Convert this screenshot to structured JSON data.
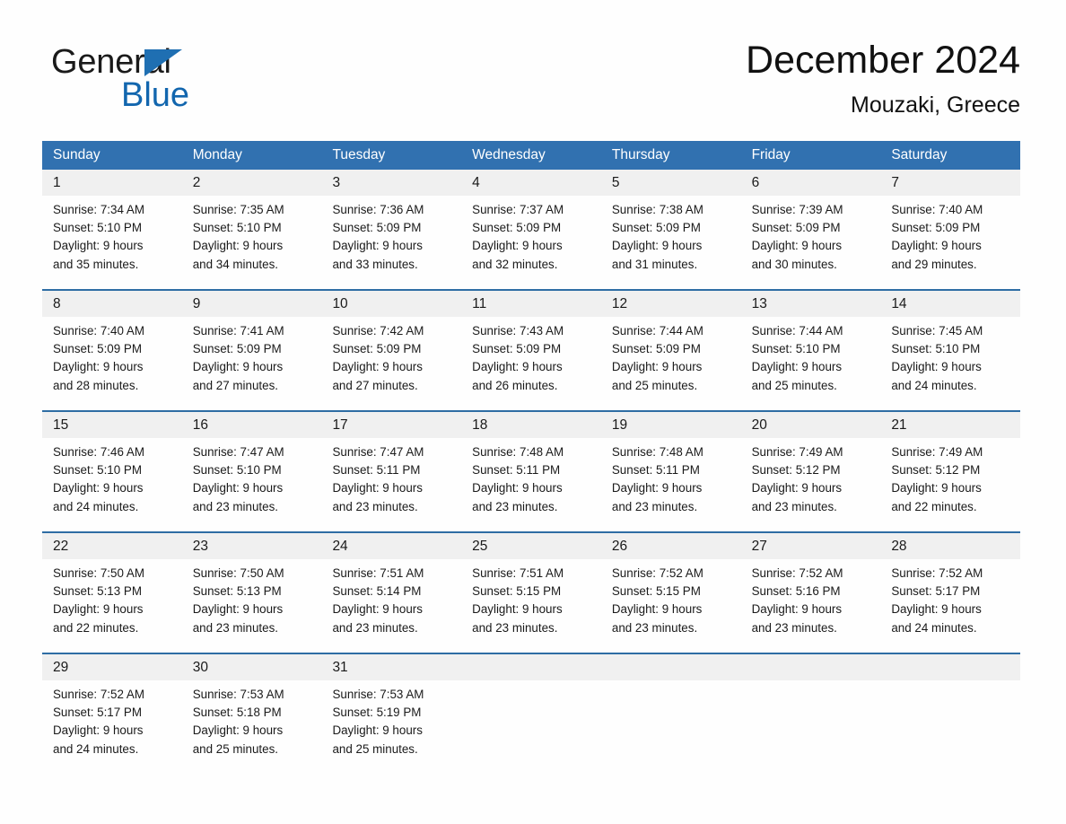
{
  "brand": {
    "name_part1": "General",
    "name_part2": "Blue",
    "triangle_color": "#1f6fb2",
    "blue_text_color": "#1266ae"
  },
  "header": {
    "title": "December 2024",
    "subtitle": "Mouzaki, Greece"
  },
  "theme": {
    "header_blue": "#3171b0",
    "divider_blue": "#2e6da4",
    "date_strip_gray": "#f0f0f0",
    "page_background": "#fefefe",
    "text_color": "#1a1a1a"
  },
  "weekdays": [
    "Sunday",
    "Monday",
    "Tuesday",
    "Wednesday",
    "Thursday",
    "Friday",
    "Saturday"
  ],
  "weeks": [
    {
      "days": [
        {
          "date": "1",
          "sunrise": "Sunrise: 7:34 AM",
          "sunset": "Sunset: 5:10 PM",
          "daylight_1": "Daylight: 9 hours",
          "daylight_2": "and 35 minutes."
        },
        {
          "date": "2",
          "sunrise": "Sunrise: 7:35 AM",
          "sunset": "Sunset: 5:10 PM",
          "daylight_1": "Daylight: 9 hours",
          "daylight_2": "and 34 minutes."
        },
        {
          "date": "3",
          "sunrise": "Sunrise: 7:36 AM",
          "sunset": "Sunset: 5:09 PM",
          "daylight_1": "Daylight: 9 hours",
          "daylight_2": "and 33 minutes."
        },
        {
          "date": "4",
          "sunrise": "Sunrise: 7:37 AM",
          "sunset": "Sunset: 5:09 PM",
          "daylight_1": "Daylight: 9 hours",
          "daylight_2": "and 32 minutes."
        },
        {
          "date": "5",
          "sunrise": "Sunrise: 7:38 AM",
          "sunset": "Sunset: 5:09 PM",
          "daylight_1": "Daylight: 9 hours",
          "daylight_2": "and 31 minutes."
        },
        {
          "date": "6",
          "sunrise": "Sunrise: 7:39 AM",
          "sunset": "Sunset: 5:09 PM",
          "daylight_1": "Daylight: 9 hours",
          "daylight_2": "and 30 minutes."
        },
        {
          "date": "7",
          "sunrise": "Sunrise: 7:40 AM",
          "sunset": "Sunset: 5:09 PM",
          "daylight_1": "Daylight: 9 hours",
          "daylight_2": "and 29 minutes."
        }
      ]
    },
    {
      "days": [
        {
          "date": "8",
          "sunrise": "Sunrise: 7:40 AM",
          "sunset": "Sunset: 5:09 PM",
          "daylight_1": "Daylight: 9 hours",
          "daylight_2": "and 28 minutes."
        },
        {
          "date": "9",
          "sunrise": "Sunrise: 7:41 AM",
          "sunset": "Sunset: 5:09 PM",
          "daylight_1": "Daylight: 9 hours",
          "daylight_2": "and 27 minutes."
        },
        {
          "date": "10",
          "sunrise": "Sunrise: 7:42 AM",
          "sunset": "Sunset: 5:09 PM",
          "daylight_1": "Daylight: 9 hours",
          "daylight_2": "and 27 minutes."
        },
        {
          "date": "11",
          "sunrise": "Sunrise: 7:43 AM",
          "sunset": "Sunset: 5:09 PM",
          "daylight_1": "Daylight: 9 hours",
          "daylight_2": "and 26 minutes."
        },
        {
          "date": "12",
          "sunrise": "Sunrise: 7:44 AM",
          "sunset": "Sunset: 5:09 PM",
          "daylight_1": "Daylight: 9 hours",
          "daylight_2": "and 25 minutes."
        },
        {
          "date": "13",
          "sunrise": "Sunrise: 7:44 AM",
          "sunset": "Sunset: 5:10 PM",
          "daylight_1": "Daylight: 9 hours",
          "daylight_2": "and 25 minutes."
        },
        {
          "date": "14",
          "sunrise": "Sunrise: 7:45 AM",
          "sunset": "Sunset: 5:10 PM",
          "daylight_1": "Daylight: 9 hours",
          "daylight_2": "and 24 minutes."
        }
      ]
    },
    {
      "days": [
        {
          "date": "15",
          "sunrise": "Sunrise: 7:46 AM",
          "sunset": "Sunset: 5:10 PM",
          "daylight_1": "Daylight: 9 hours",
          "daylight_2": "and 24 minutes."
        },
        {
          "date": "16",
          "sunrise": "Sunrise: 7:47 AM",
          "sunset": "Sunset: 5:10 PM",
          "daylight_1": "Daylight: 9 hours",
          "daylight_2": "and 23 minutes."
        },
        {
          "date": "17",
          "sunrise": "Sunrise: 7:47 AM",
          "sunset": "Sunset: 5:11 PM",
          "daylight_1": "Daylight: 9 hours",
          "daylight_2": "and 23 minutes."
        },
        {
          "date": "18",
          "sunrise": "Sunrise: 7:48 AM",
          "sunset": "Sunset: 5:11 PM",
          "daylight_1": "Daylight: 9 hours",
          "daylight_2": "and 23 minutes."
        },
        {
          "date": "19",
          "sunrise": "Sunrise: 7:48 AM",
          "sunset": "Sunset: 5:11 PM",
          "daylight_1": "Daylight: 9 hours",
          "daylight_2": "and 23 minutes."
        },
        {
          "date": "20",
          "sunrise": "Sunrise: 7:49 AM",
          "sunset": "Sunset: 5:12 PM",
          "daylight_1": "Daylight: 9 hours",
          "daylight_2": "and 23 minutes."
        },
        {
          "date": "21",
          "sunrise": "Sunrise: 7:49 AM",
          "sunset": "Sunset: 5:12 PM",
          "daylight_1": "Daylight: 9 hours",
          "daylight_2": "and 22 minutes."
        }
      ]
    },
    {
      "days": [
        {
          "date": "22",
          "sunrise": "Sunrise: 7:50 AM",
          "sunset": "Sunset: 5:13 PM",
          "daylight_1": "Daylight: 9 hours",
          "daylight_2": "and 22 minutes."
        },
        {
          "date": "23",
          "sunrise": "Sunrise: 7:50 AM",
          "sunset": "Sunset: 5:13 PM",
          "daylight_1": "Daylight: 9 hours",
          "daylight_2": "and 23 minutes."
        },
        {
          "date": "24",
          "sunrise": "Sunrise: 7:51 AM",
          "sunset": "Sunset: 5:14 PM",
          "daylight_1": "Daylight: 9 hours",
          "daylight_2": "and 23 minutes."
        },
        {
          "date": "25",
          "sunrise": "Sunrise: 7:51 AM",
          "sunset": "Sunset: 5:15 PM",
          "daylight_1": "Daylight: 9 hours",
          "daylight_2": "and 23 minutes."
        },
        {
          "date": "26",
          "sunrise": "Sunrise: 7:52 AM",
          "sunset": "Sunset: 5:15 PM",
          "daylight_1": "Daylight: 9 hours",
          "daylight_2": "and 23 minutes."
        },
        {
          "date": "27",
          "sunrise": "Sunrise: 7:52 AM",
          "sunset": "Sunset: 5:16 PM",
          "daylight_1": "Daylight: 9 hours",
          "daylight_2": "and 23 minutes."
        },
        {
          "date": "28",
          "sunrise": "Sunrise: 7:52 AM",
          "sunset": "Sunset: 5:17 PM",
          "daylight_1": "Daylight: 9 hours",
          "daylight_2": "and 24 minutes."
        }
      ]
    },
    {
      "days": [
        {
          "date": "29",
          "sunrise": "Sunrise: 7:52 AM",
          "sunset": "Sunset: 5:17 PM",
          "daylight_1": "Daylight: 9 hours",
          "daylight_2": "and 24 minutes."
        },
        {
          "date": "30",
          "sunrise": "Sunrise: 7:53 AM",
          "sunset": "Sunset: 5:18 PM",
          "daylight_1": "Daylight: 9 hours",
          "daylight_2": "and 25 minutes."
        },
        {
          "date": "31",
          "sunrise": "Sunrise: 7:53 AM",
          "sunset": "Sunset: 5:19 PM",
          "daylight_1": "Daylight: 9 hours",
          "daylight_2": "and 25 minutes."
        },
        {
          "date": "",
          "sunrise": "",
          "sunset": "",
          "daylight_1": "",
          "daylight_2": ""
        },
        {
          "date": "",
          "sunrise": "",
          "sunset": "",
          "daylight_1": "",
          "daylight_2": ""
        },
        {
          "date": "",
          "sunrise": "",
          "sunset": "",
          "daylight_1": "",
          "daylight_2": ""
        },
        {
          "date": "",
          "sunrise": "",
          "sunset": "",
          "daylight_1": "",
          "daylight_2": ""
        }
      ]
    }
  ]
}
